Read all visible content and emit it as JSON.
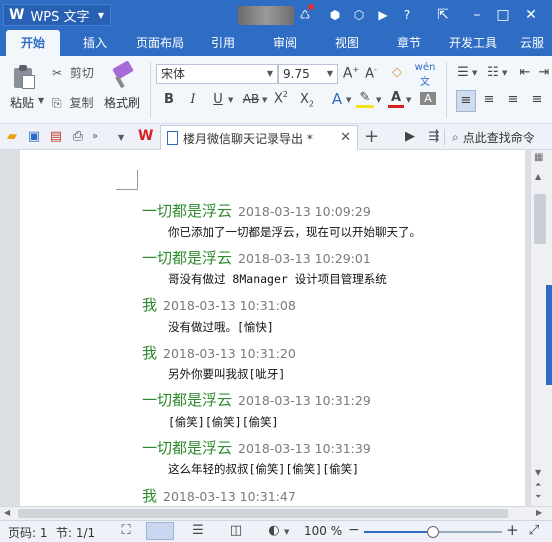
{
  "app": {
    "logo": "W",
    "name": "WPS 文字"
  },
  "menu": {
    "tabs": [
      {
        "label": "开始",
        "active": true
      },
      {
        "label": "插入"
      },
      {
        "label": "页面布局"
      },
      {
        "label": "引用"
      },
      {
        "label": "审阅"
      },
      {
        "label": "视图"
      },
      {
        "label": "章节"
      },
      {
        "label": "开发工具"
      },
      {
        "label": "云服"
      }
    ]
  },
  "ribbon": {
    "paste": "粘贴",
    "cut": "剪切",
    "copy": "复制",
    "format_painter": "格式刷",
    "font_name": "宋体",
    "font_size": "9.75"
  },
  "tabstrip": {
    "doc_title": "楼月微信聊天记录导出 *",
    "search": "点此查找命令"
  },
  "messages": [
    {
      "sender": "一切都是浮云",
      "time": "2018-03-13 10:09:29",
      "text": "你已添加了一切都是浮云，现在可以开始聊天了。"
    },
    {
      "sender": "一切都是浮云",
      "time": "2018-03-13 10:29:01",
      "text": "哥没有做过 8Manager 设计项目管理系统"
    },
    {
      "sender": "我",
      "time": "2018-03-13 10:31:08",
      "text": "没有做过哦。[愉快]"
    },
    {
      "sender": "我",
      "time": "2018-03-13 10:31:20",
      "text": "另外你要叫我叔[呲牙]"
    },
    {
      "sender": "一切都是浮云",
      "time": "2018-03-13 10:31:29",
      "text": "[偷笑][偷笑][偷笑]"
    },
    {
      "sender": "一切都是浮云",
      "time": "2018-03-13 10:31:39",
      "text": "这么年轻的叔叔[偷笑][偷笑][偷笑]"
    },
    {
      "sender": "我",
      "time": "2018-03-13 10:31:47",
      "text": ""
    }
  ],
  "status": {
    "page": "页码: 1",
    "section": "节: 1/1",
    "zoom": "100 %",
    "zoom_fraction": 0.5
  },
  "colors": {
    "accent": "#2f6dc4",
    "sender": "#2e8b2e"
  }
}
